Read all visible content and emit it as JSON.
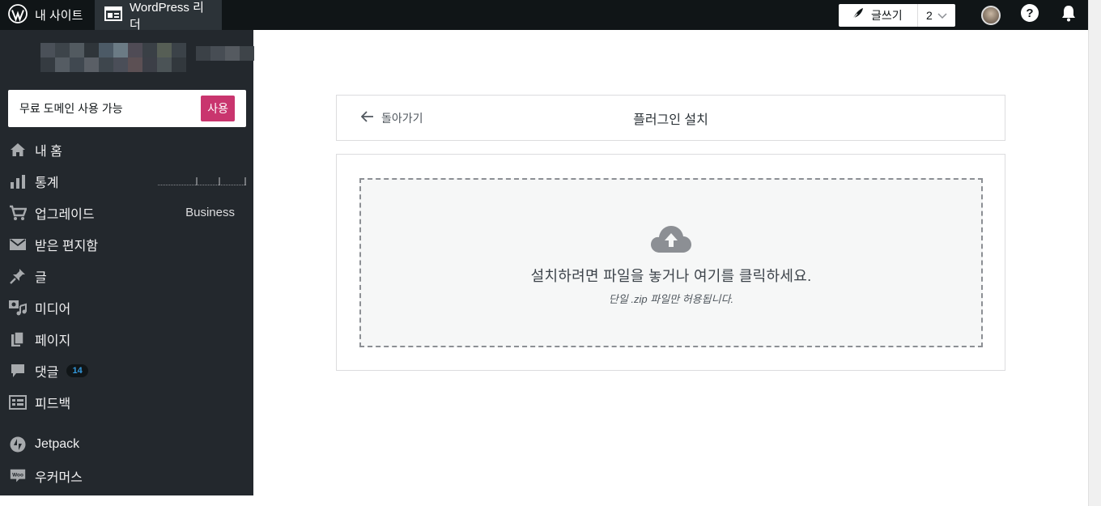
{
  "masterbar": {
    "my_site": "내 사이트",
    "reader": "WordPress 리더",
    "write": "글쓰기",
    "draft_count": "2"
  },
  "sidebar": {
    "promo_text": "무료 도메인 사용 가능",
    "promo_button": "사용",
    "items": [
      {
        "label": "내 홈",
        "icon": "home-icon"
      },
      {
        "label": "통계",
        "icon": "stats-icon"
      },
      {
        "label": "업그레이드",
        "icon": "cart-icon",
        "extra": "Business"
      },
      {
        "label": "받은 편지함",
        "icon": "mail-icon"
      },
      {
        "label": "글",
        "icon": "pin-icon"
      },
      {
        "label": "미디어",
        "icon": "media-icon"
      },
      {
        "label": "페이지",
        "icon": "pages-icon"
      },
      {
        "label": "댓글",
        "icon": "comment-icon",
        "badge": "14"
      },
      {
        "label": "피드백",
        "icon": "feedback-icon"
      },
      {
        "label": "Jetpack",
        "icon": "jetpack-icon"
      },
      {
        "label": "우커머스",
        "icon": "woo-icon"
      }
    ]
  },
  "header": {
    "back": "돌아가기",
    "title": "플러그인 설치"
  },
  "dropzone": {
    "title": "설치하려면 파일을 놓거나 여기를 클릭하세요.",
    "subtitle": "단일 .zip 파일만 허용됩니다."
  },
  "colors": {
    "masterbar": "#101517",
    "sidebar": "#23282d",
    "promo_button": "#c9356e",
    "badge_text": "#3399dd"
  }
}
